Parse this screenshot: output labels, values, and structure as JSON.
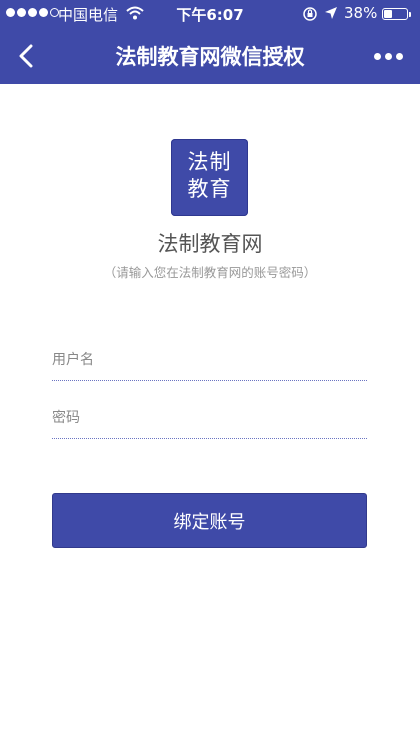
{
  "status_bar": {
    "carrier": "中国电信",
    "time": "下午6:07",
    "battery": "38%",
    "battery_level": 0.38
  },
  "nav": {
    "title": "法制教育网微信授权"
  },
  "logo": {
    "line1": "法制",
    "line2": "教育"
  },
  "site_name": "法制教育网",
  "hint": "（请输入您在法制教育网的账号密码）",
  "form": {
    "username_placeholder": "用户名",
    "username_value": "",
    "password_placeholder": "密码",
    "password_value": "",
    "submit_label": "绑定账号"
  },
  "colors": {
    "brand": "#3f4aa8",
    "background": "#ffffff"
  }
}
